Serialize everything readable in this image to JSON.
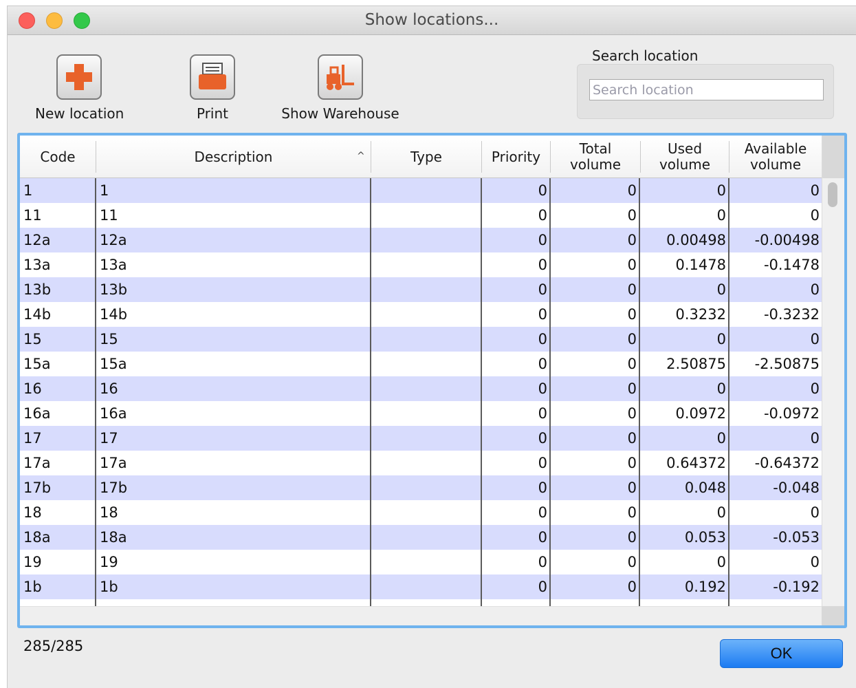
{
  "window": {
    "title": "Show locations..."
  },
  "toolbar": {
    "new_location": "New location",
    "print": "Print",
    "show_warehouse": "Show Warehouse"
  },
  "search": {
    "label": "Search location",
    "placeholder": "Search location",
    "value": ""
  },
  "table": {
    "columns": {
      "code": "Code",
      "description": "Description",
      "type": "Type",
      "priority": "Priority",
      "total_volume": [
        "Total",
        "volume"
      ],
      "used_volume": [
        "Used",
        "volume"
      ],
      "available_volume": [
        "Available",
        "volume"
      ]
    },
    "rows": [
      {
        "code": "1",
        "description": "1",
        "type": "",
        "priority": "0",
        "total": "0",
        "used": "0",
        "available": "0"
      },
      {
        "code": "11",
        "description": "11",
        "type": "",
        "priority": "0",
        "total": "0",
        "used": "0",
        "available": "0"
      },
      {
        "code": "12a",
        "description": "12a",
        "type": "",
        "priority": "0",
        "total": "0",
        "used": "0.00498",
        "available": "-0.00498"
      },
      {
        "code": "13a",
        "description": "13a",
        "type": "",
        "priority": "0",
        "total": "0",
        "used": "0.1478",
        "available": "-0.1478"
      },
      {
        "code": "13b",
        "description": "13b",
        "type": "",
        "priority": "0",
        "total": "0",
        "used": "0",
        "available": "0"
      },
      {
        "code": "14b",
        "description": "14b",
        "type": "",
        "priority": "0",
        "total": "0",
        "used": "0.3232",
        "available": "-0.3232"
      },
      {
        "code": "15",
        "description": "15",
        "type": "",
        "priority": "0",
        "total": "0",
        "used": "0",
        "available": "0"
      },
      {
        "code": "15a",
        "description": "15a",
        "type": "",
        "priority": "0",
        "total": "0",
        "used": "2.50875",
        "available": "-2.50875"
      },
      {
        "code": "16",
        "description": "16",
        "type": "",
        "priority": "0",
        "total": "0",
        "used": "0",
        "available": "0"
      },
      {
        "code": "16a",
        "description": "16a",
        "type": "",
        "priority": "0",
        "total": "0",
        "used": "0.0972",
        "available": "-0.0972"
      },
      {
        "code": "17",
        "description": "17",
        "type": "",
        "priority": "0",
        "total": "0",
        "used": "0",
        "available": "0"
      },
      {
        "code": "17a",
        "description": "17a",
        "type": "",
        "priority": "0",
        "total": "0",
        "used": "0.64372",
        "available": "-0.64372"
      },
      {
        "code": "17b",
        "description": "17b",
        "type": "",
        "priority": "0",
        "total": "0",
        "used": "0.048",
        "available": "-0.048"
      },
      {
        "code": "18",
        "description": "18",
        "type": "",
        "priority": "0",
        "total": "0",
        "used": "0",
        "available": "0"
      },
      {
        "code": "18a",
        "description": "18a",
        "type": "",
        "priority": "0",
        "total": "0",
        "used": "0.053",
        "available": "-0.053"
      },
      {
        "code": "19",
        "description": "19",
        "type": "",
        "priority": "0",
        "total": "0",
        "used": "0",
        "available": "0"
      },
      {
        "code": "1b",
        "description": "1b",
        "type": "",
        "priority": "0",
        "total": "0",
        "used": "0.192",
        "available": "-0.192"
      }
    ]
  },
  "footer": {
    "count": "285/285",
    "ok_label": "OK"
  },
  "colors": {
    "row_alt": "#d8dcfd",
    "focus_ring": "#6fb3ee",
    "ok_button": "#1c7bf2",
    "icon_accent": "#e8622a"
  },
  "icons": {
    "new_location": "plus-icon",
    "print": "printer-icon",
    "show_warehouse": "forklift-icon"
  }
}
